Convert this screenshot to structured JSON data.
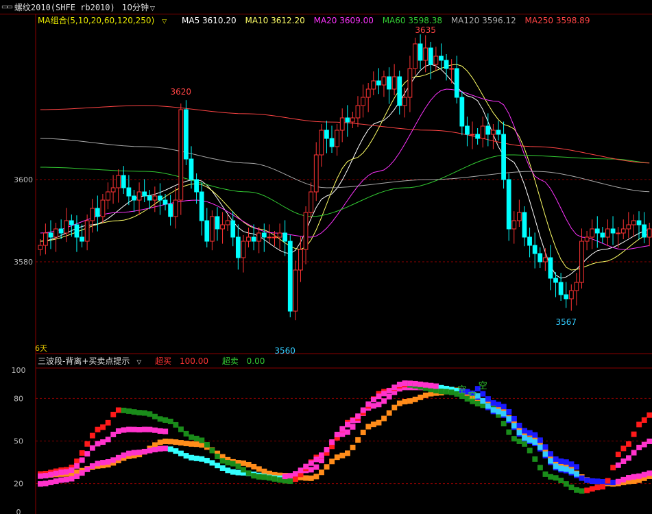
{
  "header": {
    "window_icon": "window-icon",
    "symbol": "螺纹2010(SHFE rb2010)",
    "period": "10分钟"
  },
  "ma_legend": {
    "title": "MA组合(5,10,20,60,120,250)",
    "items": [
      {
        "label": "MA5 3610.20",
        "color": "#ffffff"
      },
      {
        "label": "MA10 3612.20",
        "color": "#ffff66"
      },
      {
        "label": "MA20 3609.00",
        "color": "#ff33ff"
      },
      {
        "label": "MA60 3598.38",
        "color": "#33cc33"
      },
      {
        "label": "MA120 3596.12",
        "color": "#aaaaaa"
      },
      {
        "label": "MA250 3598.89",
        "color": "#ff4444"
      }
    ]
  },
  "indicator_legend": {
    "title": "三波段-背离+买卖点提示",
    "buy_label": "超买",
    "buy_value": "100.00",
    "sell_label": "超卖",
    "sell_value": "0.00"
  },
  "annotations": {
    "days": "6天",
    "signal_char": "空"
  },
  "chart_data": [
    {
      "type": "candlestick",
      "title": "螺纹2010(SHFE rb2010) 10分钟",
      "y_ticks": [
        3580,
        3600
      ],
      "ylim": [
        3556,
        3640
      ],
      "price_labels": [
        {
          "text": "3620",
          "value": 3620,
          "bar_index": 27
        },
        {
          "text": "3635",
          "value": 3635,
          "bar_index": 74
        },
        {
          "text": "3560",
          "value": 3560,
          "bar_index": 47
        },
        {
          "text": "3567",
          "value": 3567,
          "bar_index": 101
        }
      ],
      "close": [
        3584,
        3587,
        3586,
        3588,
        3587,
        3590,
        3589,
        3586,
        3585,
        3590,
        3593,
        3591,
        3595,
        3597,
        3598,
        3601,
        3598,
        3596,
        3595,
        3597,
        3596,
        3595,
        3596,
        3595,
        3594,
        3591,
        3595,
        3617,
        3605,
        3600,
        3597,
        3590,
        3585,
        3591,
        3588,
        3589,
        3590,
        3586,
        3581,
        3585,
        3586,
        3585,
        3587,
        3586,
        3586,
        3586,
        3587,
        3585,
        3568,
        3578,
        3583,
        3592,
        3597,
        3606,
        3612,
        3610,
        3608,
        3612,
        3615,
        3614,
        3615,
        3618,
        3620,
        3622,
        3624,
        3623,
        3625,
        3622,
        3625,
        3618,
        3620,
        3627,
        3633,
        3629,
        3632,
        3628,
        3630,
        3629,
        3627,
        3627,
        3620,
        3613,
        3611,
        3611,
        3610,
        3613,
        3611,
        3612,
        3611,
        3600,
        3588,
        3590,
        3592,
        3586,
        3584,
        3582,
        3580,
        3581,
        3576,
        3575,
        3572,
        3571,
        3573,
        3575,
        3585,
        3586,
        3588,
        3587,
        3586,
        3588,
        3587,
        3587,
        3588,
        3589,
        3590,
        3589,
        3586,
        3588
      ],
      "ma_series": [
        {
          "name": "MA5",
          "color": "#ffffff",
          "anchors": [
            [
              0,
              3585
            ],
            [
              10,
              3589
            ],
            [
              20,
              3596
            ],
            [
              30,
              3600
            ],
            [
              40,
              3587
            ],
            [
              48,
              3582
            ],
            [
              55,
              3596
            ],
            [
              65,
              3614
            ],
            [
              75,
              3628
            ],
            [
              83,
              3620
            ],
            [
              90,
              3605
            ],
            [
              100,
              3576
            ],
            [
              108,
              3583
            ],
            [
              118,
              3588
            ]
          ]
        },
        {
          "name": "MA10",
          "color": "#ffff66",
          "anchors": [
            [
              0,
              3585
            ],
            [
              15,
              3590
            ],
            [
              30,
              3599
            ],
            [
              42,
              3588
            ],
            [
              50,
              3583
            ],
            [
              60,
              3605
            ],
            [
              72,
              3625
            ],
            [
              80,
              3628
            ],
            [
              90,
              3613
            ],
            [
              102,
              3578
            ],
            [
              108,
              3580
            ],
            [
              118,
              3587
            ]
          ]
        },
        {
          "name": "MA20",
          "color": "#ff33ff",
          "anchors": [
            [
              0,
              3587
            ],
            [
              15,
              3592
            ],
            [
              30,
              3595
            ],
            [
              45,
              3587
            ],
            [
              52,
              3586
            ],
            [
              65,
              3602
            ],
            [
              78,
              3622
            ],
            [
              88,
              3619
            ],
            [
              96,
              3600
            ],
            [
              104,
              3586
            ],
            [
              112,
              3583
            ],
            [
              118,
              3584
            ]
          ]
        },
        {
          "name": "MA60",
          "color": "#33cc33",
          "anchors": [
            [
              0,
              3603
            ],
            [
              20,
              3602
            ],
            [
              40,
              3597
            ],
            [
              52,
              3591
            ],
            [
              70,
              3598
            ],
            [
              90,
              3606
            ],
            [
              110,
              3605
            ],
            [
              118,
              3604
            ]
          ]
        },
        {
          "name": "MA120",
          "color": "#aaaaaa",
          "anchors": [
            [
              0,
              3610
            ],
            [
              20,
              3608
            ],
            [
              40,
              3604
            ],
            [
              55,
              3598
            ],
            [
              75,
              3600
            ],
            [
              95,
              3602
            ],
            [
              118,
              3597
            ]
          ]
        },
        {
          "name": "MA250",
          "color": "#ff4444",
          "anchors": [
            [
              0,
              3617
            ],
            [
              20,
              3618
            ],
            [
              40,
              3616
            ],
            [
              55,
              3614
            ],
            [
              75,
              3612
            ],
            [
              95,
              3608
            ],
            [
              118,
              3604
            ]
          ]
        }
      ]
    },
    {
      "type": "area",
      "title": "三波段-背离+买卖点提示",
      "y_ticks": [
        0,
        20,
        50,
        80,
        100
      ],
      "ylim": [
        0,
        100
      ],
      "overbought": 100,
      "oversold": 0,
      "series": [
        {
          "name": "red/green band",
          "anchors": [
            [
              0,
              27
            ],
            [
              5,
              30
            ],
            [
              12,
              60
            ],
            [
              15,
              72
            ],
            [
              20,
              70
            ],
            [
              24,
              65
            ],
            [
              30,
              52
            ],
            [
              36,
              35
            ],
            [
              42,
              25
            ],
            [
              48,
              22
            ],
            [
              54,
              40
            ],
            [
              60,
              65
            ],
            [
              66,
              85
            ],
            [
              70,
              90
            ],
            [
              78,
              85
            ],
            [
              86,
              75
            ],
            [
              92,
              50
            ],
            [
              98,
              25
            ],
            [
              104,
              15
            ],
            [
              108,
              18
            ],
            [
              112,
              45
            ],
            [
              116,
              65
            ],
            [
              118,
              72
            ]
          ]
        },
        {
          "name": "magenta band",
          "anchors": [
            [
              0,
              20
            ],
            [
              5,
              23
            ],
            [
              12,
              35
            ],
            [
              18,
              42
            ],
            [
              24,
              45
            ],
            [
              30,
              38
            ],
            [
              38,
              28
            ],
            [
              46,
              24
            ],
            [
              52,
              30
            ],
            [
              58,
              55
            ],
            [
              64,
              75
            ],
            [
              70,
              88
            ],
            [
              76,
              88
            ],
            [
              82,
              85
            ],
            [
              88,
              70
            ],
            [
              94,
              50
            ],
            [
              100,
              30
            ],
            [
              106,
              22
            ],
            [
              110,
              21
            ],
            [
              114,
              25
            ],
            [
              118,
              28
            ]
          ]
        },
        {
          "name": "orange band",
          "anchors": [
            [
              0,
              26
            ],
            [
              5,
              27
            ],
            [
              12,
              33
            ],
            [
              18,
              40
            ],
            [
              24,
              50
            ],
            [
              30,
              48
            ],
            [
              38,
              35
            ],
            [
              46,
              26
            ],
            [
              52,
              24
            ],
            [
              58,
              40
            ],
            [
              64,
              62
            ],
            [
              70,
              78
            ],
            [
              76,
              84
            ],
            [
              80,
              86
            ],
            [
              86,
              78
            ],
            [
              94,
              55
            ],
            [
              100,
              33
            ],
            [
              106,
              22
            ],
            [
              110,
              20
            ],
            [
              114,
              22
            ],
            [
              118,
              26
            ]
          ]
        }
      ]
    }
  ]
}
